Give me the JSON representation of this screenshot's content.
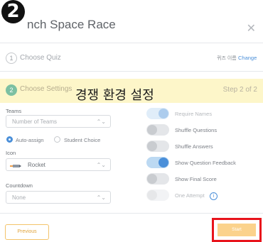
{
  "step_marker": "2",
  "dialog": {
    "title": "nch Space Race",
    "close_icon": "close-icon"
  },
  "steps": [
    {
      "number": "1",
      "label": "Choose Quiz",
      "right_text": "퀴즈 이름",
      "right_link": "Change"
    },
    {
      "number": "2",
      "label": "Choose Settings",
      "right_text": "Step 2 of 2"
    }
  ],
  "banner": {
    "text": "경쟁 환경 설정",
    "color": "#fdf6c9"
  },
  "settings": {
    "teams_label": "Teams",
    "teams_value": "Number of Teams",
    "auto_assign": "Auto-assign",
    "student_choice": "Student Choice",
    "icon_label": "Icon",
    "icon_value": "Rocket",
    "countdown_label": "Countdown",
    "countdown_value": "None"
  },
  "toggles": [
    {
      "label": "Require Names",
      "on": true
    },
    {
      "label": "Shuffle Questions",
      "on": false
    },
    {
      "label": "Shuffle Answers",
      "on": false
    },
    {
      "label": "Show Question Feedback",
      "on": true
    },
    {
      "label": "Show Final Score",
      "on": false
    },
    {
      "label": "One Attempt",
      "on": false,
      "info_icon": "info-icon"
    }
  ],
  "footer": {
    "previous": "Previous",
    "start": "Start"
  },
  "colors": {
    "accent": "#4a8fd9",
    "start_button": "#fbd28c",
    "highlight_box": "#e8141c"
  }
}
